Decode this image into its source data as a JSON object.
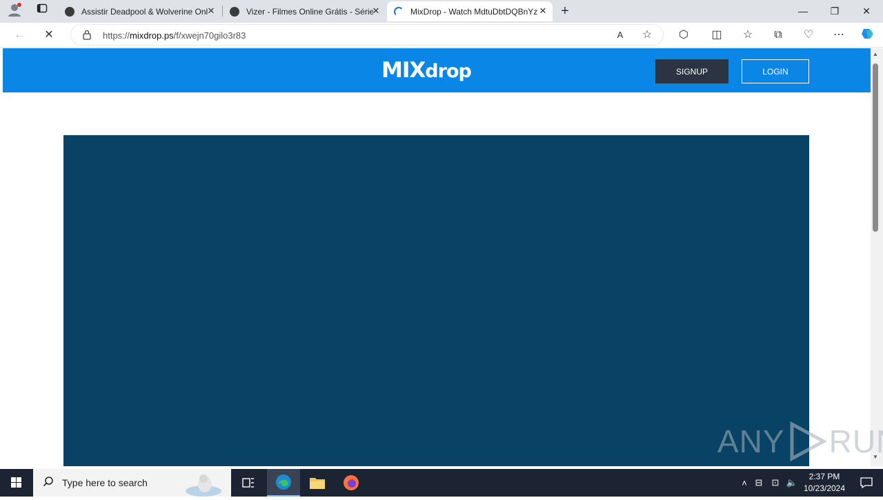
{
  "browser": {
    "tabs": [
      {
        "title": "Assistir Deadpool & Wolverine Online",
        "favicon": "shield-favicon",
        "active": false
      },
      {
        "title": "Vizer - Filmes Online Grátis - Séries",
        "favicon": "shield-favicon",
        "active": false
      },
      {
        "title": "MixDrop - Watch MdtuDbtDQBnYz",
        "favicon": "loading-spinner",
        "active": true
      }
    ],
    "address": {
      "prefix": "https://",
      "domain": "mixdrop.ps",
      "path": "/f/xwejn70gilo3r83"
    }
  },
  "site": {
    "logo_big": "MIX",
    "logo_small": "drop",
    "signup_label": "SIGNUP",
    "login_label": "LOGIN",
    "colors": {
      "header": "#0a86e6",
      "player": "#084264"
    }
  },
  "watermark": {
    "text_left": "ANY",
    "text_right": "RUN"
  },
  "taskbar": {
    "search_placeholder": "Type here to search",
    "time": "2:37 PM",
    "date": "10/23/2024"
  }
}
